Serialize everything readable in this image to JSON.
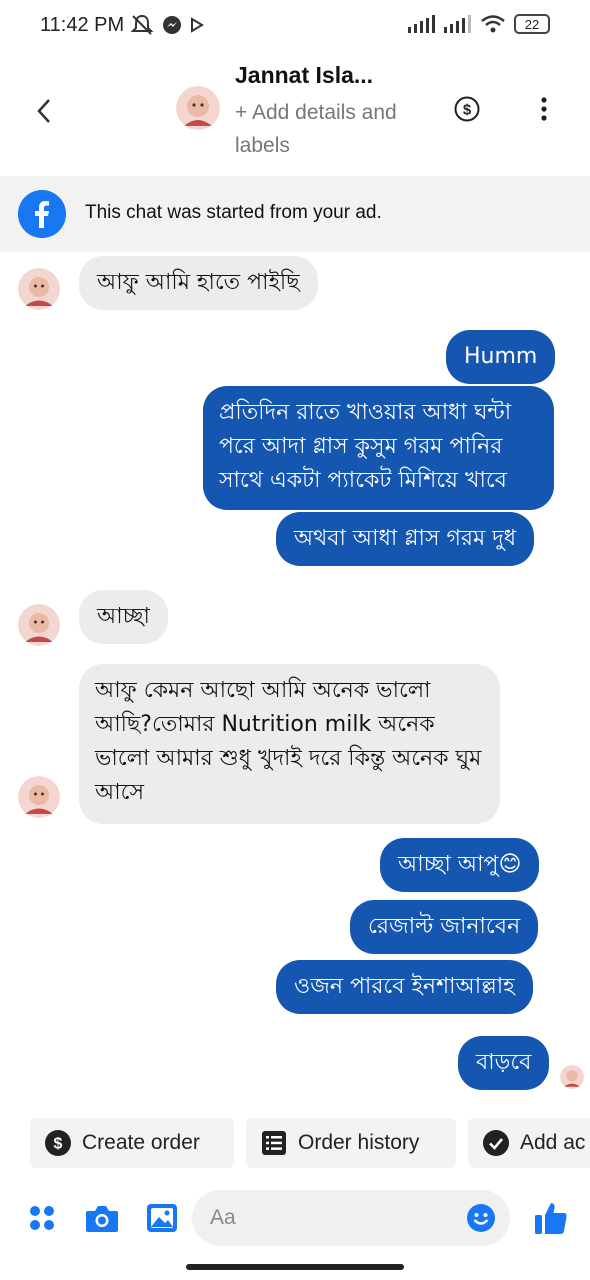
{
  "status_bar": {
    "time": "11:42 PM",
    "battery": "22"
  },
  "header": {
    "title": "Jannat Isla...",
    "subtitle": "+ Add details and labels"
  },
  "banner": {
    "text": "This chat was started from your ad."
  },
  "messages": [
    {
      "side": "in",
      "text": "আফু আমি হাতে পাইছি"
    },
    {
      "side": "out",
      "text": "Humm"
    },
    {
      "side": "out",
      "text": "প্রতিদিন রাতে খাওয়ার আধা ঘন্টা পরে আদা গ্লাস কুসুম গরম পানির সাথে একটা প্যাকেট মিশিয়ে খাবে"
    },
    {
      "side": "out",
      "text": "অথবা আধা গ্লাস গরম দুধ"
    },
    {
      "side": "in",
      "text": "আচ্ছা"
    },
    {
      "side": "in",
      "text": "আফু কেমন আছো আমি অনেক ভালো আছি?তোমার  Nutrition milk অনেক ভালো আমার শুধু খুদাই দরে কিন্তু অনেক ঘুম আসে"
    },
    {
      "side": "out",
      "text": "আচ্ছা আপু😊"
    },
    {
      "side": "out",
      "text": "রেজাল্ট জানাবেন"
    },
    {
      "side": "out",
      "text": "ওজন পারবে ইনশাআল্লাহ"
    },
    {
      "side": "out",
      "text": "বাড়বে"
    }
  ],
  "quick_actions": [
    {
      "label": "Create order",
      "icon": "dollar-circle-icon"
    },
    {
      "label": "Order history",
      "icon": "receipt-icon"
    },
    {
      "label": "Add ac",
      "icon": "check-circle-icon"
    }
  ],
  "composer": {
    "placeholder": "Aa"
  },
  "colors": {
    "outgoing_bubble": "#1557b0",
    "incoming_bubble": "#ececec",
    "accent": "#1877f2"
  }
}
